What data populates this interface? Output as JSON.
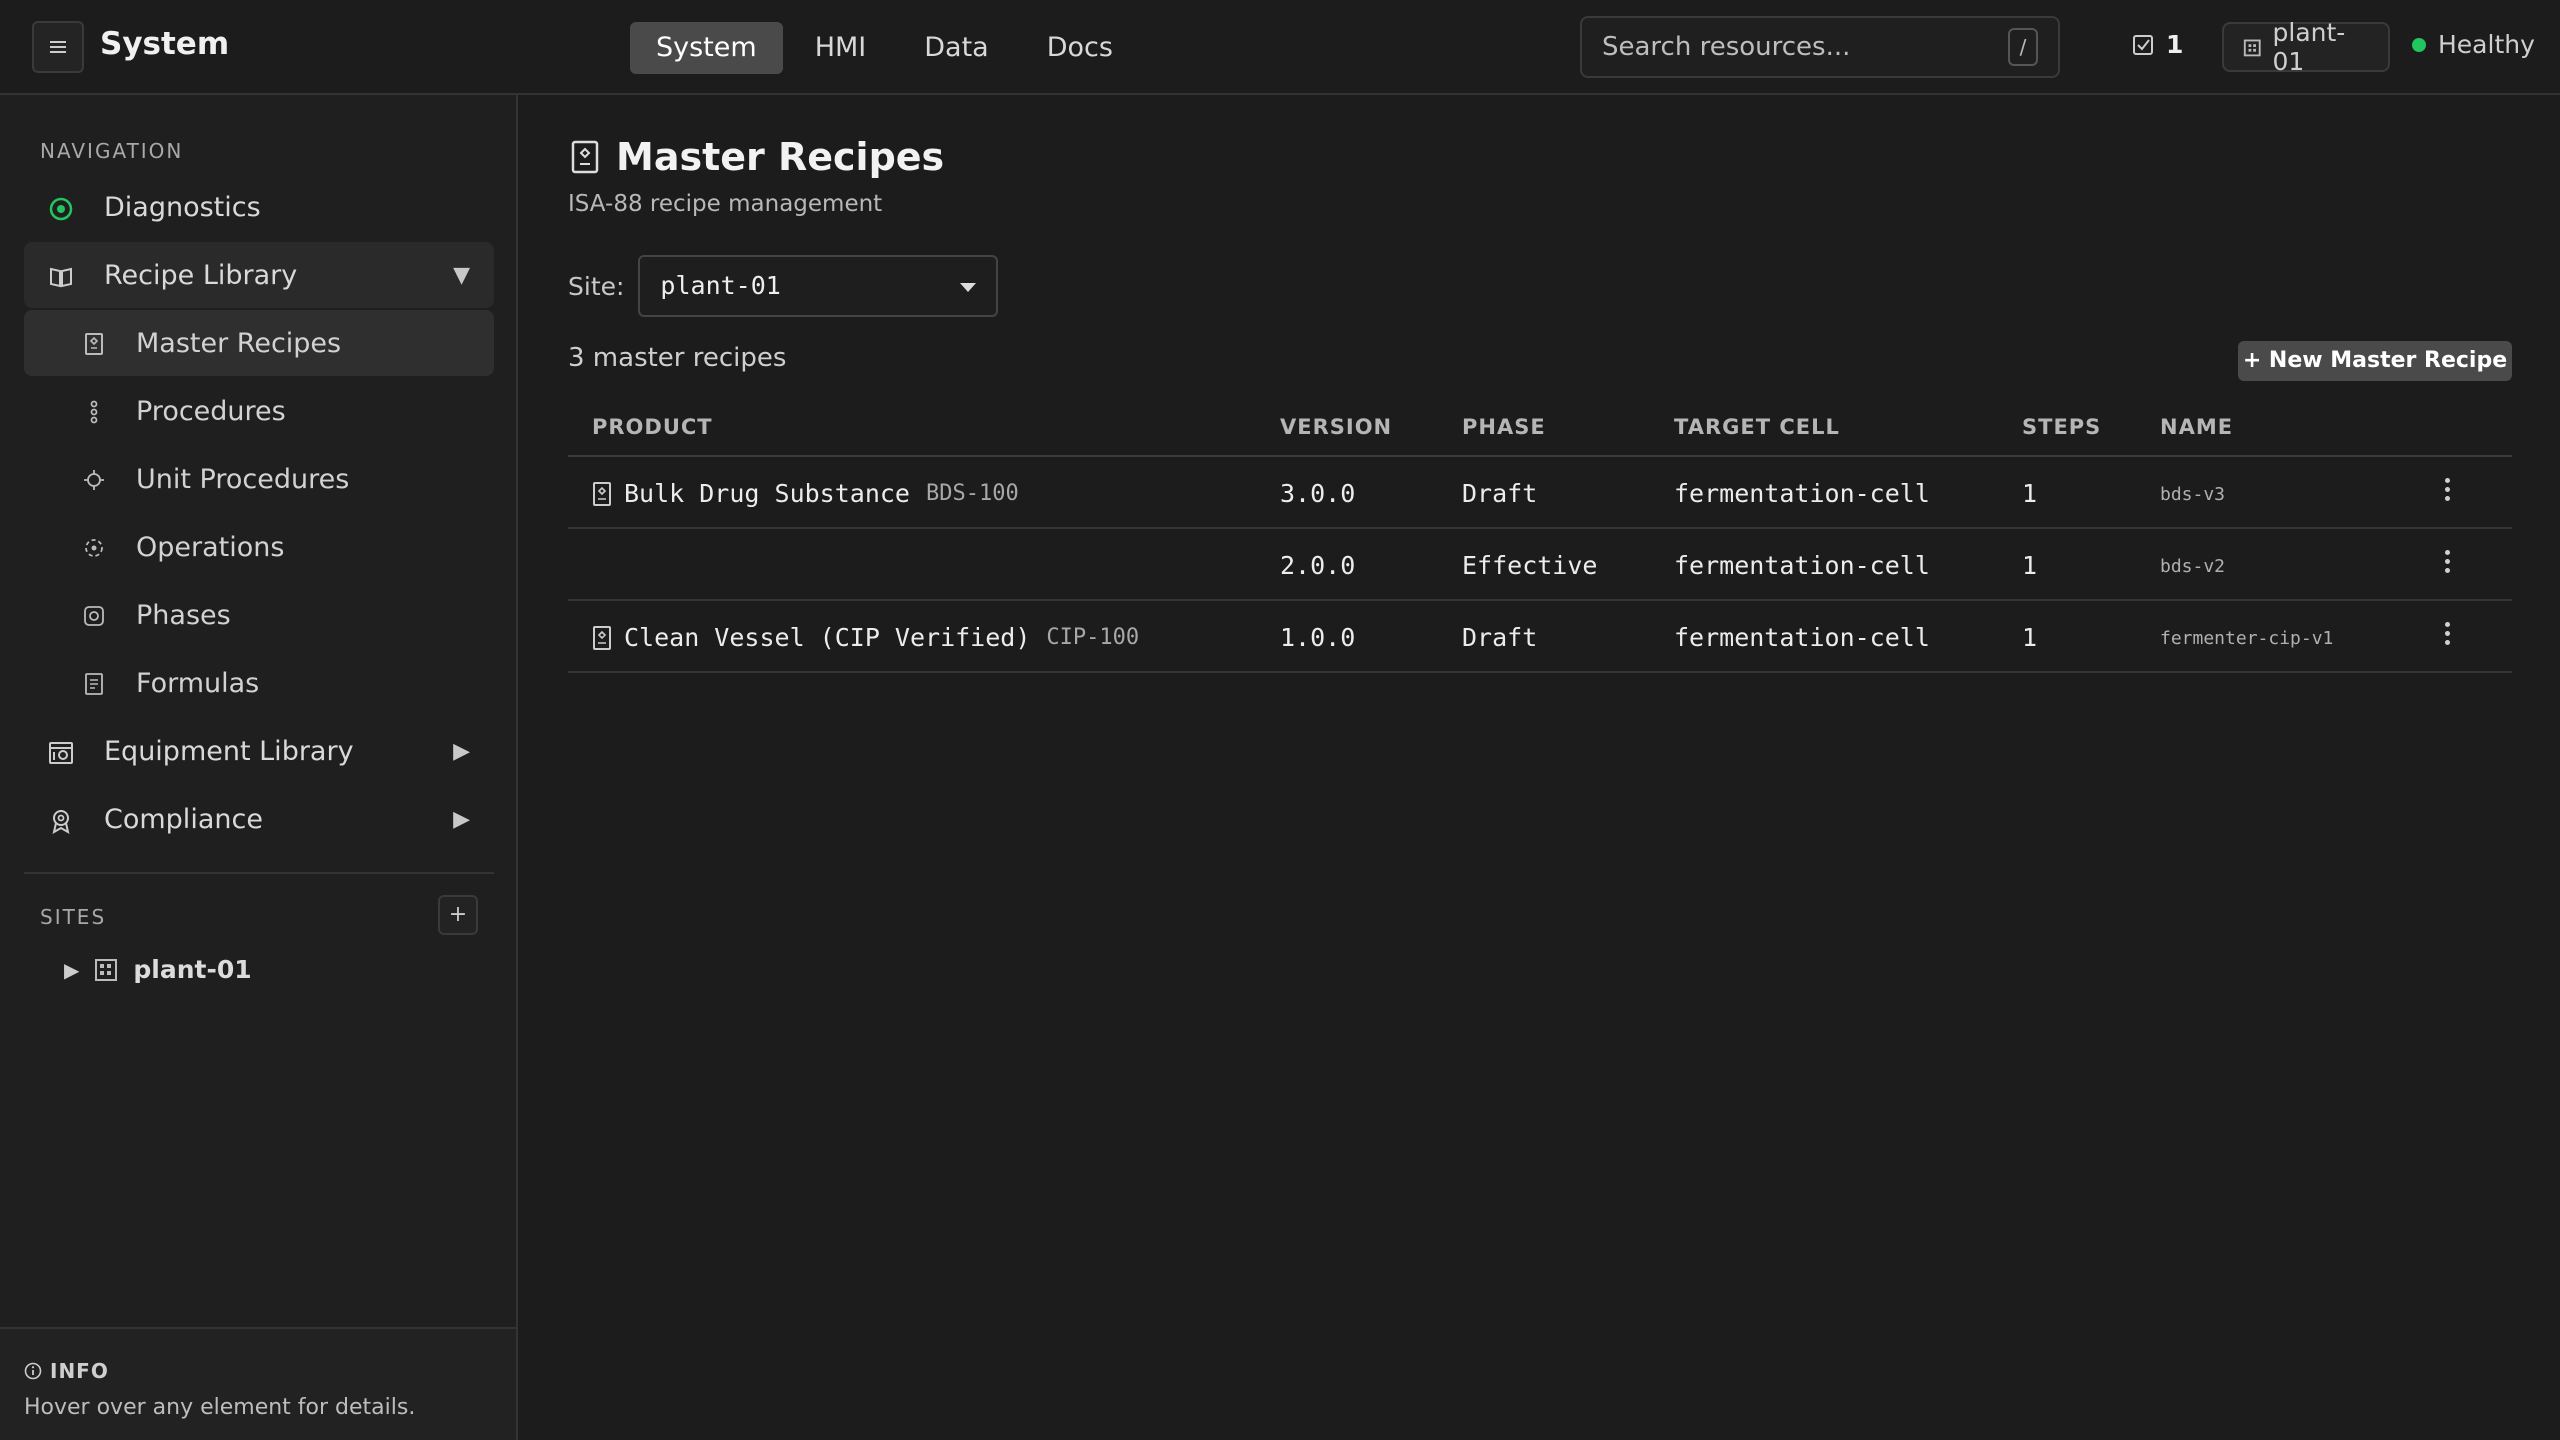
{
  "app": {
    "title": "System"
  },
  "topbar": {
    "tabs": [
      {
        "label": "System",
        "active": true
      },
      {
        "label": "HMI",
        "active": false
      },
      {
        "label": "Data",
        "active": false
      },
      {
        "label": "Docs",
        "active": false
      }
    ],
    "search": {
      "placeholder": "Search resources...",
      "shortcut": "/"
    },
    "task_count": "1",
    "site_chip": "plant-01",
    "health": {
      "label": "Healthy",
      "color": "#22c55e"
    }
  },
  "sidebar": {
    "navigation_label": "NAVIGATION",
    "items": [
      {
        "label": "Diagnostics",
        "icon": "target-icon"
      },
      {
        "label": "Recipe Library",
        "icon": "book-icon",
        "expanded": true
      },
      {
        "label": "Equipment Library",
        "icon": "equipment-icon",
        "expanded": false
      },
      {
        "label": "Compliance",
        "icon": "badge-icon",
        "expanded": false
      }
    ],
    "recipe_children": [
      {
        "label": "Master Recipes",
        "icon": "recipe-icon",
        "active": true
      },
      {
        "label": "Procedures",
        "icon": "procedure-icon"
      },
      {
        "label": "Unit Procedures",
        "icon": "unit-procedure-icon"
      },
      {
        "label": "Operations",
        "icon": "operation-icon"
      },
      {
        "label": "Phases",
        "icon": "phase-icon"
      },
      {
        "label": "Formulas",
        "icon": "formula-icon"
      }
    ],
    "sites_label": "SITES",
    "add_site": "+",
    "sites": [
      {
        "label": "plant-01"
      }
    ],
    "info": {
      "title": "INFO",
      "text": "Hover over any element for details."
    }
  },
  "main": {
    "title": "Master Recipes",
    "subtitle": "ISA-88 recipe management",
    "site_filter": {
      "label": "Site:",
      "value": "plant-01"
    },
    "count_text": "3 master recipes",
    "new_button": "+ New Master Recipe",
    "columns": [
      "PRODUCT",
      "VERSION",
      "PHASE",
      "TARGET CELL",
      "STEPS",
      "NAME"
    ],
    "rows": [
      {
        "product": "Bulk Drug Substance",
        "code": "BDS-100",
        "version": "3.0.0",
        "phase": "Draft",
        "target_cell": "fermentation-cell",
        "steps": "1",
        "name": "bds-v3"
      },
      {
        "product": "",
        "code": "",
        "version": "2.0.0",
        "phase": "Effective",
        "target_cell": "fermentation-cell",
        "steps": "1",
        "name": "bds-v2"
      },
      {
        "product": "Clean Vessel (CIP Verified)",
        "code": "CIP-100",
        "version": "1.0.0",
        "phase": "Draft",
        "target_cell": "fermentation-cell",
        "steps": "1",
        "name": "fermenter-cip-v1"
      }
    ]
  }
}
